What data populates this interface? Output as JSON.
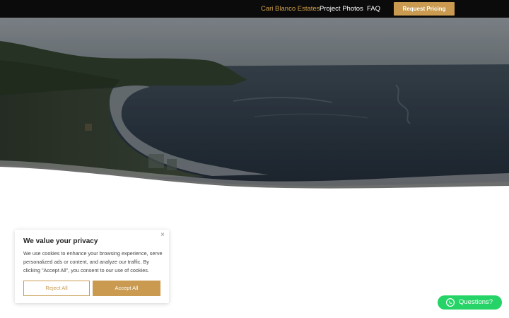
{
  "nav": {
    "links": [
      {
        "label": "Cari Blanco Estates",
        "active": true
      },
      {
        "label": "Project Photos",
        "active": false
      },
      {
        "label": "FAQ",
        "active": false
      }
    ],
    "cta_label": "Request Pricing"
  },
  "cookie_banner": {
    "title": "We value your privacy",
    "body": "We use cookies to enhance your browsing experience, serve personalized ads or content, and analyze our traffic. By clicking \"Accept All\", you consent to our use of cookies.",
    "close_symbol": "×",
    "reject_label": "Reject All",
    "accept_label": "Accept All"
  },
  "chat": {
    "label": "Questions?",
    "icon": "whatsapp-icon"
  },
  "colors": {
    "accent_gold": "#c99a4f",
    "active_link": "#d2a24b",
    "nav_background": "#0b0b0b",
    "chat_green": "#25d366"
  }
}
